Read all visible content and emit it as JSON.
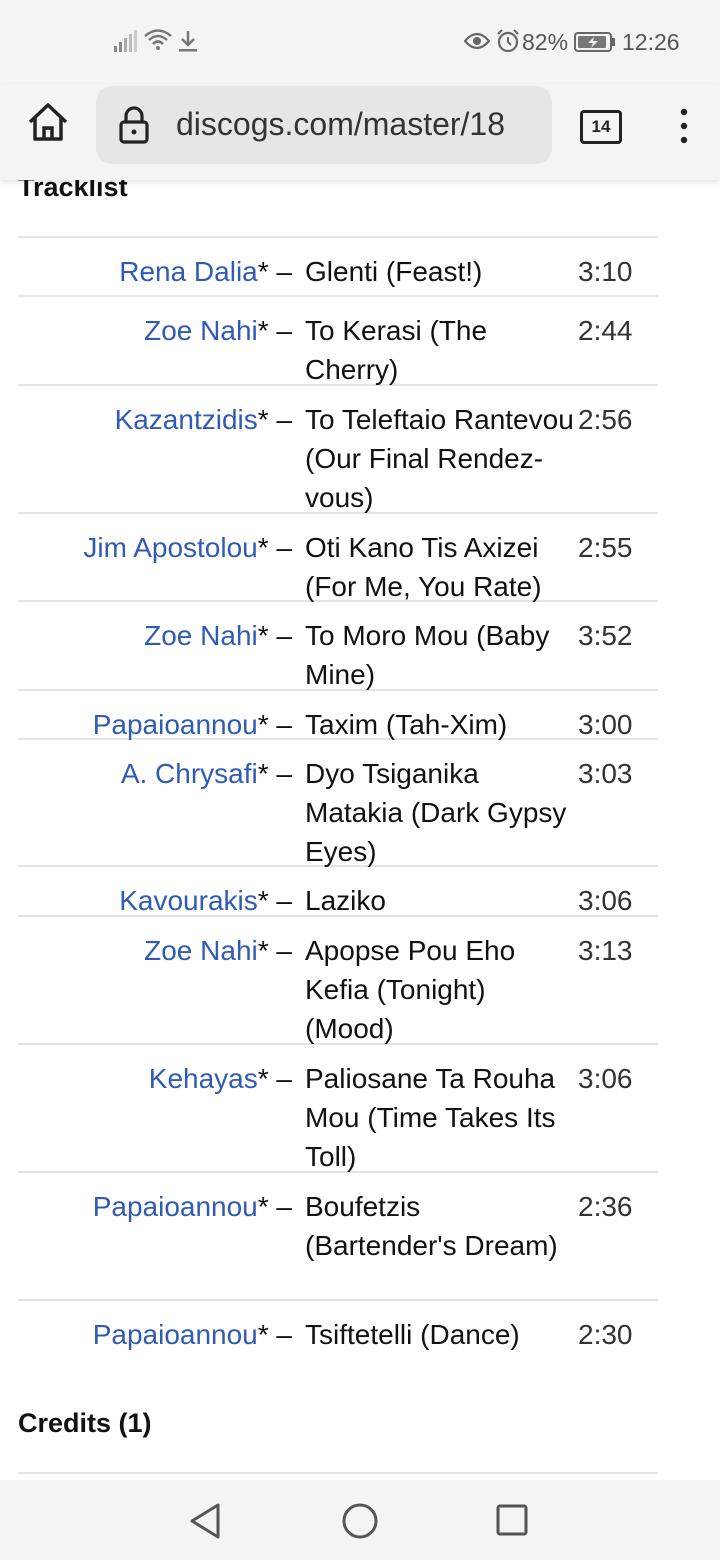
{
  "status_bar": {
    "battery": "82%",
    "time": "12:26",
    "icons": [
      "signal-icon",
      "wifi-icon",
      "download-icon",
      "eye-icon",
      "alarm-icon",
      "battery-icon"
    ]
  },
  "browser": {
    "url": "discogs.com/master/18",
    "tab_count": "14",
    "icons": [
      "home-icon",
      "lock-icon",
      "menu-icon"
    ]
  },
  "tracklist": {
    "heading": "Tracklist",
    "separator": "* –",
    "tracks": [
      {
        "artist": "Rena Dalia",
        "title": "Glenti (Feast!)",
        "duration": "3:10"
      },
      {
        "artist": "Zoe Nahi",
        "title": "To Kerasi (The Cherry)",
        "duration": "2:44"
      },
      {
        "artist": "Kazantzidis",
        "title": "To Teleftaio Rantevou (Our Final Rendez-vous)",
        "duration": "2:56"
      },
      {
        "artist": "Jim Apostolou",
        "title": "Oti Kano Tis Axizei (For Me, You Rate)",
        "duration": "2:55"
      },
      {
        "artist": "Zoe Nahi",
        "title": "To Moro Mou (Baby Mine)",
        "duration": "3:52"
      },
      {
        "artist": "Papaioannou",
        "title": "Taxim (Tah-Xim)",
        "duration": "3:00"
      },
      {
        "artist": "A. Chrysafi",
        "title": "Dyo Tsiganika Matakia (Dark Gypsy Eyes)",
        "duration": "3:03"
      },
      {
        "artist": "Kavourakis",
        "title": "Laziko",
        "duration": "3:06"
      },
      {
        "artist": "Zoe Nahi",
        "title": "Apopse Pou Eho Kefia (Tonight) (Mood)",
        "duration": "3:13"
      },
      {
        "artist": "Kehayas",
        "title": "Paliosane Ta Rouha Mou (Time Takes Its Toll)",
        "duration": "3:06"
      },
      {
        "artist": "Papaioannou",
        "title": "Boufetzis (Bartender's Dream)",
        "duration": "2:36"
      },
      {
        "artist": "Papaioannou",
        "title": "Tsiftetelli (Dance)",
        "duration": "2:30"
      }
    ]
  },
  "credits": {
    "heading": "Credits (1)"
  },
  "nav_bar": {
    "icons": [
      "back-icon",
      "home-circle-icon",
      "recents-icon"
    ]
  }
}
